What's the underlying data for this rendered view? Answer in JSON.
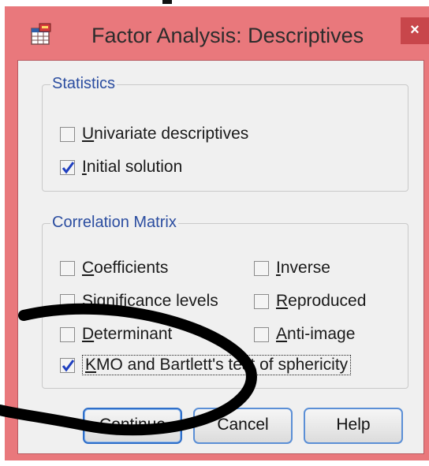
{
  "window": {
    "title": "Factor Analysis: Descriptives",
    "close_glyph": "×",
    "icon": "spss-dialog-icon"
  },
  "statistics": {
    "legend": "Statistics",
    "items": [
      {
        "mnemonic": "U",
        "rest": "nivariate descriptives",
        "checked": false
      },
      {
        "mnemonic": "I",
        "rest": "nitial solution",
        "checked": true
      }
    ]
  },
  "correlation_matrix": {
    "legend": "Correlation Matrix",
    "left": [
      {
        "mnemonic": "C",
        "rest": "oefficients",
        "checked": false
      },
      {
        "mnemonic": "S",
        "rest": "ignificance levels",
        "checked": false
      },
      {
        "mnemonic": "D",
        "rest": "eterminant",
        "checked": false
      },
      {
        "mnemonic": "K",
        "rest": "MO and Bartlett's test of sphericity",
        "checked": true
      }
    ],
    "right": [
      {
        "mnemonic": "I",
        "rest": "nverse",
        "checked": false
      },
      {
        "mnemonic": "R",
        "rest": "eproduced",
        "checked": false
      },
      {
        "mnemonic": "A",
        "rest": "nti-image",
        "checked": false
      }
    ]
  },
  "buttons": {
    "continue": "Continue",
    "cancel": "Cancel",
    "help": "Help"
  },
  "colors": {
    "window_frame": "#e9787c",
    "close_button": "#c8464b",
    "legend_text": "#2b4da0",
    "checkmark": "#1f3fbf",
    "annotation_stroke": "#000000"
  }
}
